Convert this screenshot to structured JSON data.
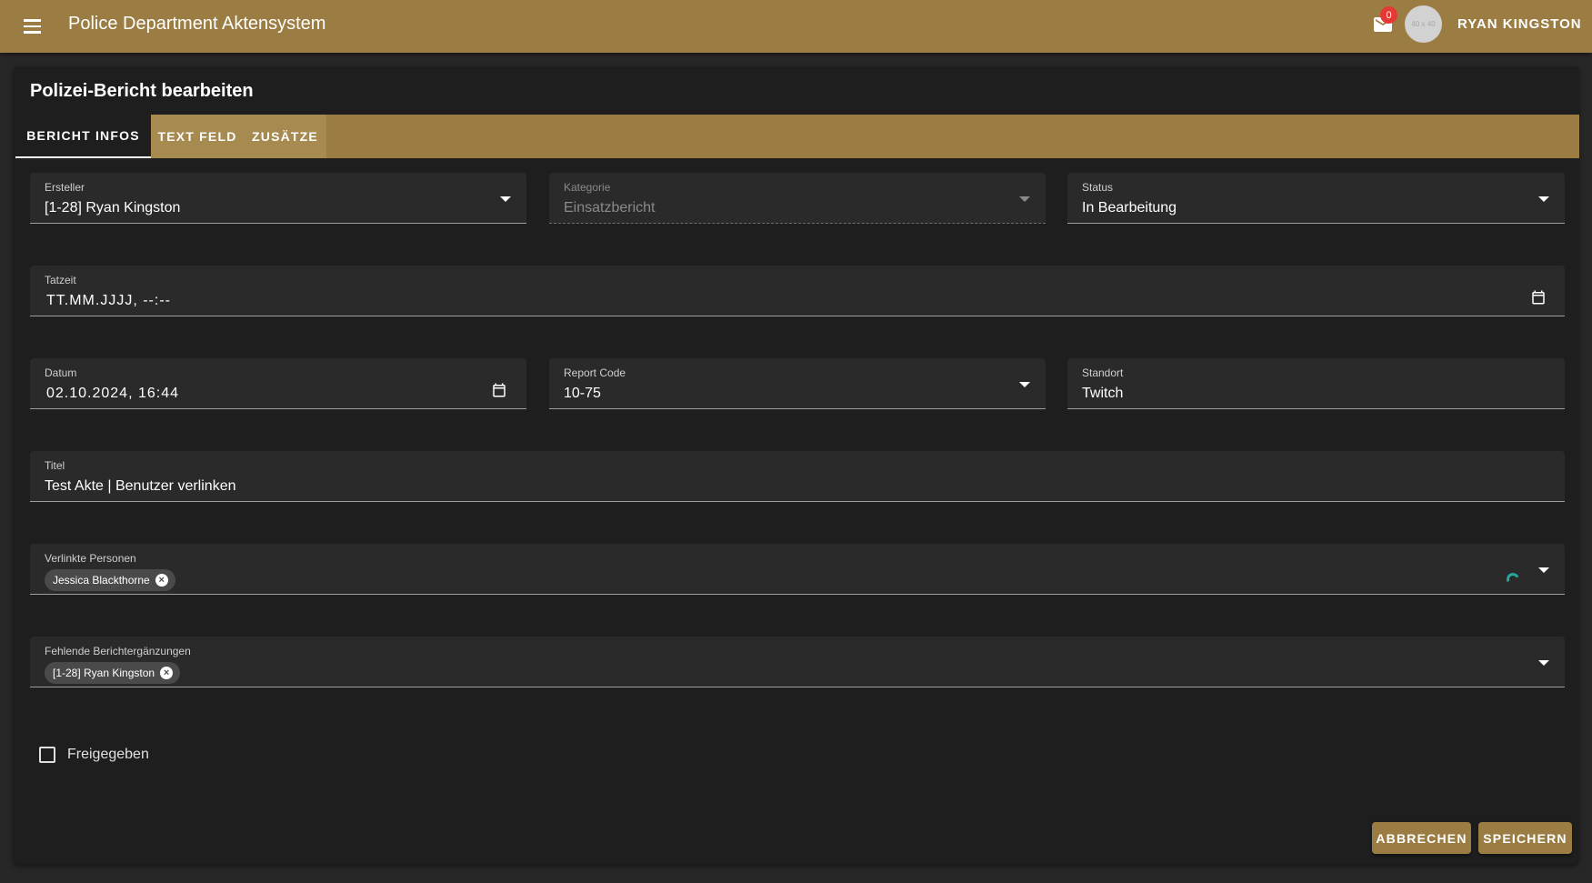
{
  "header": {
    "title": "Police Department Aktensystem",
    "mail_count": "0",
    "avatar_placeholder": "40 x 40",
    "user_name": "RYAN KINGSTON",
    "bar_color": "#9b7d43"
  },
  "form": {
    "title": "Polizei-Bericht bearbeiten",
    "tabs": [
      "BERICHT INFOS",
      "TEXT FELD",
      "ZUSÄTZE"
    ],
    "ersteller": {
      "label": "Ersteller",
      "value": "[1-28] Ryan Kingston"
    },
    "kategorie": {
      "label": "Kategorie",
      "value": "Einsatzbericht"
    },
    "status": {
      "label": "Status",
      "value": "In Bearbeitung"
    },
    "tatzeit": {
      "label": "Tatzeit",
      "value": "TT.MM.JJJJ, --:--"
    },
    "datum": {
      "label": "Datum",
      "value": "02.10.2024, 16:44"
    },
    "report_code": {
      "label": "Report Code",
      "value": "10-75"
    },
    "standort": {
      "label": "Standort",
      "value": "Twitch"
    },
    "titel": {
      "label": "Titel",
      "value": "Test Akte | Benutzer verlinken"
    },
    "verlinkte_personen": {
      "label": "Verlinkte Personen",
      "chips": [
        "Jessica Blackthorne"
      ]
    },
    "fehlende_ergaenzungen": {
      "label": "Fehlende Berichtergänzungen",
      "chips": [
        "[1-28] Ryan Kingston"
      ]
    },
    "freigegeben": {
      "label": "Freigegeben",
      "checked": false
    },
    "buttons": {
      "cancel": "ABBRECHEN",
      "save": "SPEICHERN"
    }
  },
  "icons": [
    "menu-icon",
    "mail-icon",
    "chevron-down-icon",
    "calendar-icon",
    "close-circle-icon",
    "loading-spinner-icon",
    "checkbox-icon"
  ]
}
